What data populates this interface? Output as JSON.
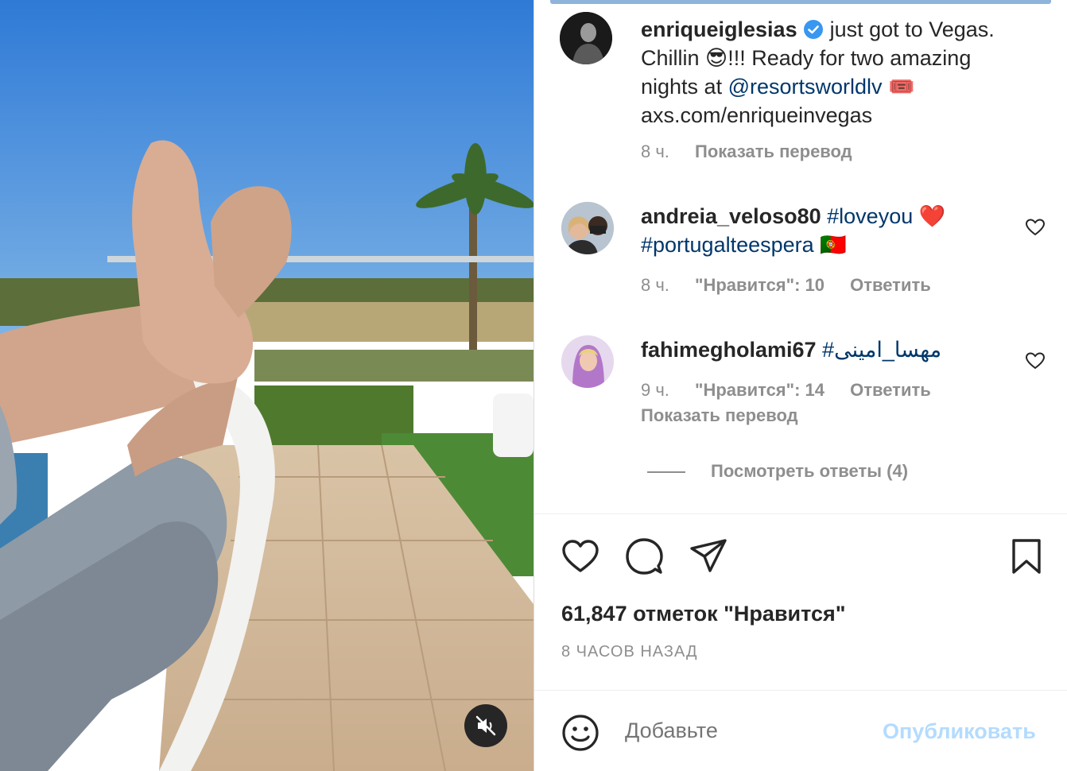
{
  "post": {
    "author": "enriqueiglesias",
    "caption_line1": "just got to Vegas.",
    "caption_line2a": "Chillin",
    "caption_line2b": "!!! Ready for two amazing",
    "caption_line3a": "nights at",
    "caption_mention": "@resortsworldlv",
    "caption_line4": "axs.com/enriqueinvegas",
    "emoji_cool": "😎",
    "emoji_ticket": "🎟️",
    "time": "8 ч.",
    "translate": "Показать перевод"
  },
  "comments": [
    {
      "user": "andreia_veloso80",
      "tag1": "#loveyou",
      "emoji1": "❤️",
      "tag2": "#portugalteespera",
      "emoji2": "🇵🇹",
      "time": "8 ч.",
      "likes": "\"Нравится\": 10",
      "reply": "Ответить"
    },
    {
      "user": "fahimegholami67",
      "tag1": "#مهسا_امینی",
      "time": "9 ч.",
      "likes": "\"Нравится\": 14",
      "reply": "Ответить",
      "translate": "Показать перевод",
      "view_replies": "Посмотреть ответы (4)"
    }
  ],
  "likes_count": "61,847 отметок \"Нравится\"",
  "posted_ago": "8 ЧАСОВ НАЗАД",
  "comment_box": {
    "placeholder": "Добавьте",
    "publish": "Опубликовать"
  },
  "colors": {
    "link": "#00376b",
    "muted": "#8e8e8e",
    "publish_disabled": "#b3dbff",
    "verified": "#3897f0"
  }
}
